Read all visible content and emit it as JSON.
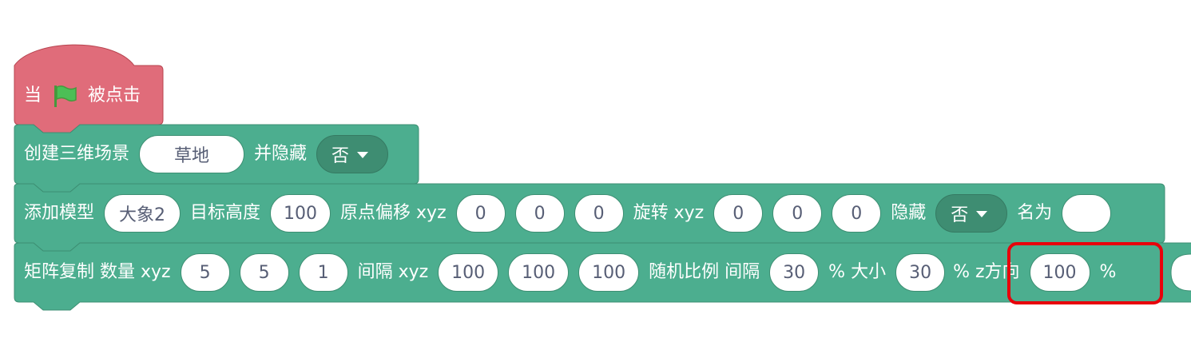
{
  "colors": {
    "event_block": "#e06c7a",
    "event_border": "#b7444f",
    "pen_block": "#4cae8f",
    "pen_border": "#3d8f73",
    "dropdown": "#3e8d72",
    "input_text": "#575e75",
    "highlight": "#e8000b",
    "flag_green": "#4cbf56"
  },
  "hat_block": {
    "label_when": "当",
    "flag_icon": "green-flag-icon",
    "label_clicked": "被点击"
  },
  "scene_block": {
    "label_create": "创建三维场景",
    "scene_value": "草地",
    "label_hide": "并隐藏",
    "hide_value": "否"
  },
  "model_block": {
    "label_add": "添加模型",
    "model_value": "大象2",
    "label_height": "目标高度",
    "height_value": "100",
    "label_origin": "原点偏移 xyz",
    "origin_x": "0",
    "origin_y": "0",
    "origin_z": "0",
    "label_rotate": "旋转 xyz",
    "rot_x": "0",
    "rot_y": "0",
    "rot_z": "0",
    "label_hidden": "隐藏",
    "hidden_value": "否",
    "label_name": "名为",
    "name_value": ""
  },
  "array_block": {
    "label_copy": "矩阵复制 数量 xyz",
    "count_x": "5",
    "count_y": "5",
    "count_z": "1",
    "label_spacing": "间隔 xyz",
    "spacing_x": "100",
    "spacing_y": "100",
    "spacing_z": "100",
    "label_random": "随机比例 间隔",
    "random_spacing": "30",
    "label_pct_size": "% 大小",
    "random_size": "30",
    "label_pct_z": "% z方向",
    "z_value": "100",
    "label_pct_end": "%"
  }
}
